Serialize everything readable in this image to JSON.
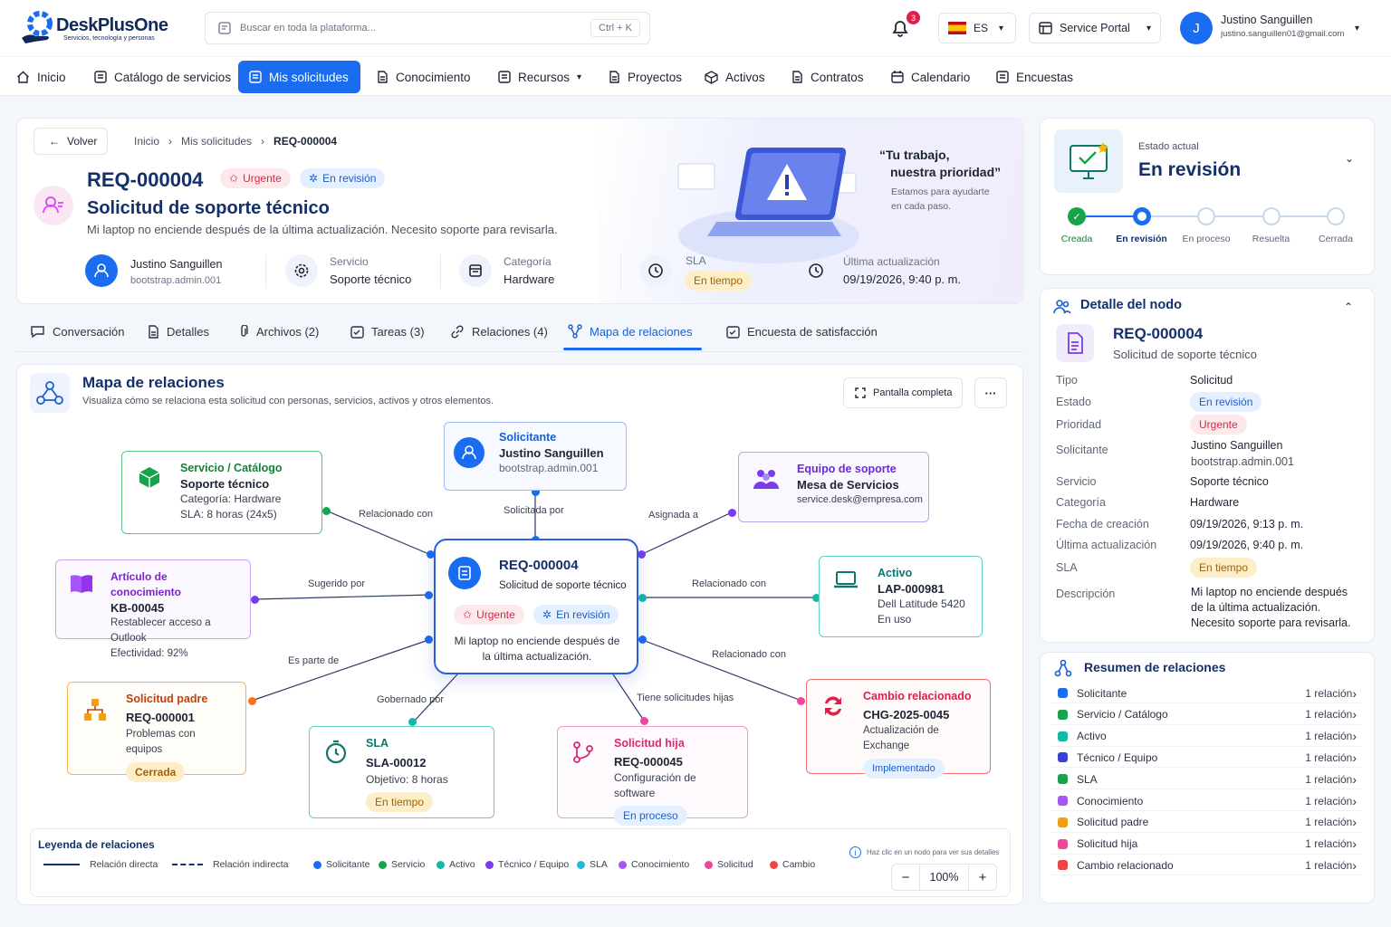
{
  "brand": {
    "name": "DeskPlusOne",
    "tagline": "Servicios, tecnología y personas"
  },
  "search": {
    "placeholder": "Buscar en toda la plataforma...",
    "shortcut": "Ctrl + K"
  },
  "header": {
    "notif_count": "3",
    "lang": "ES",
    "portal": "Service Portal",
    "user_initial": "J",
    "user_name": "Justino Sanguillen",
    "user_email": "justino.sanguillen01@gmail.com"
  },
  "nav": [
    "Inicio",
    "Catálogo de servicios",
    "Mis solicitudes",
    "Conocimiento",
    "Recursos",
    "Proyectos",
    "Activos",
    "Contratos",
    "Calendario",
    "Encuestas"
  ],
  "breadcrumb": {
    "back": "Volver",
    "items": [
      "Inicio",
      "Mis solicitudes",
      "REQ-000004"
    ]
  },
  "ticket": {
    "id": "REQ-000004",
    "priority": "Urgente",
    "status": "En revisión",
    "title": "Solicitud de soporte técnico",
    "description": "Mi laptop no enciende después de la última actualización. Necesito soporte para revisarla."
  },
  "meta": {
    "user_name": "Justino Sanguillen",
    "user_login": "bootstrap.admin.001",
    "service_label": "Servicio",
    "service": "Soporte técnico",
    "category_label": "Categoría",
    "category": "Hardware",
    "sla_label": "SLA",
    "sla": "En tiempo",
    "updated_label": "Última actualización",
    "updated": "09/19/2026, 9:40 p. m."
  },
  "hero": {
    "quote1": "“Tu trabajo,",
    "quote2": "nuestra prioridad”",
    "sub1": "Estamos para ayudarte",
    "sub2": "en cada paso."
  },
  "tabs": [
    "Conversación",
    "Detalles",
    "Archivos (2)",
    "Tareas (3)",
    "Relaciones (4)",
    "Mapa de relaciones",
    "Encuesta de satisfacción"
  ],
  "map": {
    "title": "Mapa de relaciones",
    "subtitle": "Visualiza cómo se relaciona esta solicitud con personas, servicios, activos y otros elementos.",
    "fullscreen": "Pantalla completa",
    "more": "···"
  },
  "nodes": {
    "center": {
      "id": "REQ-000004",
      "title": "Solicitud de soporte técnico",
      "priority": "Urgente",
      "status": "En revisión",
      "desc": "Mi laptop no enciende después de la última actualización."
    },
    "requester": {
      "type": "Solicitante",
      "name": "Justino Sanguillen",
      "sub": "bootstrap.admin.001"
    },
    "service": {
      "type": "Servicio / Catálogo",
      "name": "Soporte técnico",
      "l1": "Categoría: Hardware",
      "l2": "SLA: 8 horas (24x5)"
    },
    "team": {
      "type": "Equipo de soporte",
      "name": "Mesa de Servicios",
      "sub": "service.desk@empresa.com"
    },
    "kb": {
      "type": "Artículo de conocimiento",
      "name": "KB-00045",
      "l1": "Restablecer acceso a Outlook",
      "l2": "Efectividad: 92%"
    },
    "asset": {
      "type": "Activo",
      "name": "LAP-000981",
      "l1": "Dell Latitude 5420",
      "l2": "En uso"
    },
    "parent": {
      "type": "Solicitud padre",
      "name": "REQ-000001",
      "sub": "Problemas con equipos",
      "badge": "Cerrada"
    },
    "sla": {
      "type": "SLA",
      "name": "SLA-00012",
      "sub": "Objetivo: 8 horas",
      "badge": "En tiempo"
    },
    "child": {
      "type": "Solicitud hija",
      "name": "REQ-000045",
      "sub": "Configuración de software",
      "badge": "En proceso"
    },
    "change": {
      "type": "Cambio relacionado",
      "name": "CHG-2025-0045",
      "sub": "Actualización de Exchange",
      "badge": "Implementado"
    }
  },
  "edges": {
    "e_service": "Relacionado con",
    "e_requester": "Solicitada por",
    "e_team": "Asignada a",
    "e_kb": "Sugerido por",
    "e_asset": "Relacionado con",
    "e_parent": "Es parte de",
    "e_change": "Relacionado con",
    "e_sla": "Gobernado por",
    "e_child": "Tiene solicitudes hijas"
  },
  "legend": {
    "title": "Leyenda de relaciones",
    "direct": "Relación directa",
    "indirect": "Relación indirecta",
    "items": [
      {
        "label": "Solicitante",
        "color": "#1a6cf0"
      },
      {
        "label": "Servicio",
        "color": "#16a34a"
      },
      {
        "label": "Activo",
        "color": "#14b8a6"
      },
      {
        "label": "Técnico / Equipo",
        "color": "#7c3aed"
      },
      {
        "label": "SLA",
        "color": "#22b8d8"
      },
      {
        "label": "Conocimiento",
        "color": "#a855f7"
      },
      {
        "label": "Solicitud",
        "color": "#ec4899"
      },
      {
        "label": "Cambio",
        "color": "#ef4444"
      }
    ],
    "hint": "Haz clic en un nodo para ver sus detalles",
    "zoom": "100%"
  },
  "state": {
    "label": "Estado actual",
    "value": "En revisión",
    "steps": [
      "Creada",
      "En revisión",
      "En proceso",
      "Resuelta",
      "Cerrada"
    ],
    "current": 1
  },
  "node_detail": {
    "title": "Detalle del nodo",
    "id": "REQ-000004",
    "subtitle": "Solicitud de soporte técnico",
    "rows": {
      "tipo_k": "Tipo",
      "tipo_v": "Solicitud",
      "estado_k": "Estado",
      "estado_v": "En revisión",
      "prio_k": "Prioridad",
      "prio_v": "Urgente",
      "sol_k": "Solicitante",
      "sol_v1": "Justino Sanguillen",
      "sol_v2": "bootstrap.admin.001",
      "serv_k": "Servicio",
      "serv_v": "Soporte técnico",
      "cat_k": "Categoría",
      "cat_v": "Hardware",
      "fc_k": "Fecha de creación",
      "fc_v": "09/19/2026, 9:13 p. m.",
      "ua_k": "Última actualización",
      "ua_v": "09/19/2026, 9:40 p. m.",
      "sla_k": "SLA",
      "sla_v": "En tiempo",
      "desc_k": "Descripción",
      "desc_v1": "Mi laptop no enciende después",
      "desc_v2": "de la última actualización.",
      "desc_v3": "Necesito soporte para revisarla."
    }
  },
  "summary": {
    "title": "Resumen de relaciones",
    "items": [
      {
        "name": "Solicitante",
        "count": "1 relación",
        "color": "#1a6cf0"
      },
      {
        "name": "Servicio / Catálogo",
        "count": "1 relación",
        "color": "#16a34a"
      },
      {
        "name": "Activo",
        "count": "1 relación",
        "color": "#14b8a6"
      },
      {
        "name": "Técnico / Equipo",
        "count": "1 relación",
        "color": "#3b3fd8"
      },
      {
        "name": "SLA",
        "count": "1 relación",
        "color": "#16a34a"
      },
      {
        "name": "Conocimiento",
        "count": "1 relación",
        "color": "#a855f7"
      },
      {
        "name": "Solicitud padre",
        "count": "1 relación",
        "color": "#f59e0b"
      },
      {
        "name": "Solicitud hija",
        "count": "1 relación",
        "color": "#ec4899"
      },
      {
        "name": "Cambio relacionado",
        "count": "1 relación",
        "color": "#ef4444"
      }
    ]
  }
}
